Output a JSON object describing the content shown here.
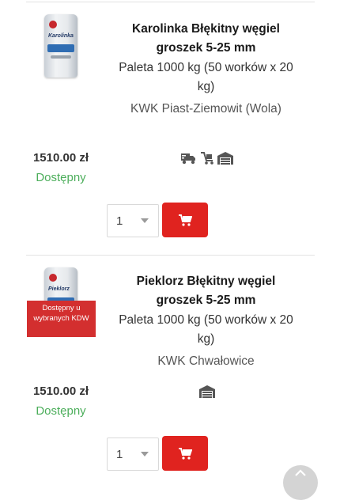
{
  "products": [
    {
      "title": "Karolinka Błękitny węgiel groszek 5-25 mm",
      "subtitle": "Paleta 1000 kg (50 worków x 20 kg)",
      "mine": "KWK Piast-Ziemowit (Wola)",
      "price": "1510.00 zł",
      "availability": "Dostępny",
      "quantity": "1",
      "bag_brand": "Karolinka",
      "icons": [
        "delivery-truck-icon",
        "pallet-jack-icon",
        "warehouse-icon"
      ]
    },
    {
      "title": "Pieklorz Błękitny węgiel groszek 5-25 mm",
      "subtitle": "Paleta 1000 kg (50 worków x 20 kg)",
      "mine": "KWK Chwałowice",
      "price": "1510.00 zł",
      "availability": "Dostępny",
      "quantity": "1",
      "bag_brand": "Pieklorz",
      "badge": "Dostępny u wybranych KDW",
      "icons": [
        "warehouse-icon"
      ]
    }
  ],
  "colors": {
    "accent_red": "#e0231f",
    "available_green": "#4cae5b",
    "badge_red": "#d32f2f"
  }
}
